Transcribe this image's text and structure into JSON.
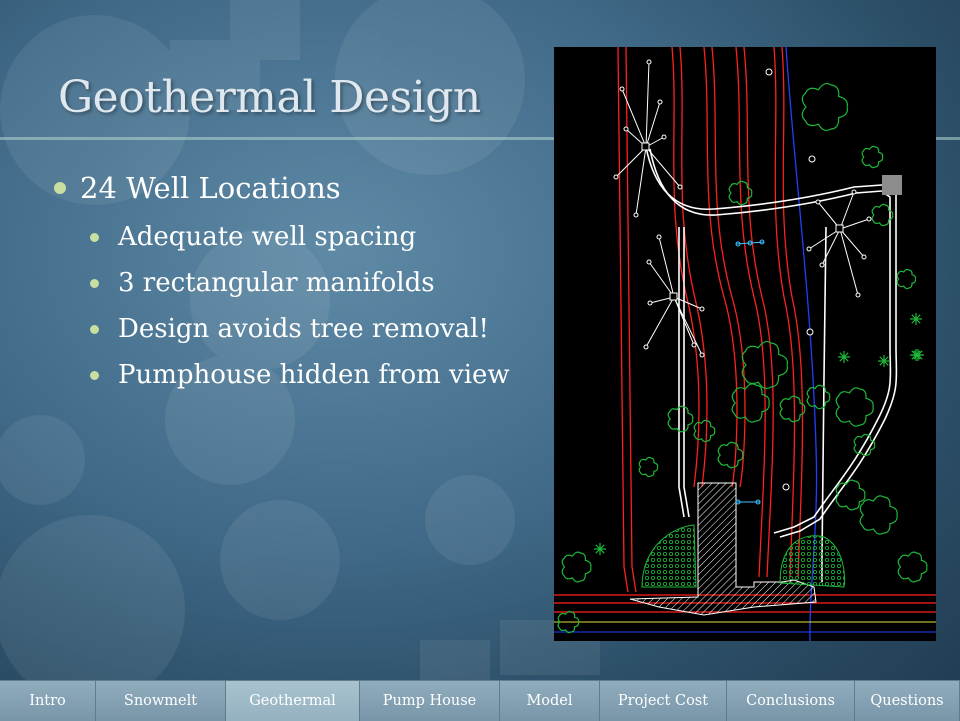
{
  "slide": {
    "title": "Geothermal Design",
    "bullets": [
      {
        "text": "24 Well Locations",
        "sub": [
          "Adequate well spacing",
          "3 rectangular manifolds",
          "Design avoids tree removal!",
          "Pumphouse hidden from view"
        ]
      }
    ]
  },
  "nav": {
    "items": [
      "Intro",
      "Snowmelt",
      "Geothermal",
      "Pump House",
      "Model",
      "Project Cost",
      "Conclusions",
      "Questions"
    ],
    "active": "Geothermal"
  },
  "colors": {
    "accent_bullet": "#c7dfa0",
    "cad_background": "#000000",
    "cad_red": "#ff2020",
    "cad_green": "#1fb83a",
    "cad_blue": "#2040ff",
    "cad_white": "#ffffff",
    "nav_bar": "#7f9eb0"
  }
}
